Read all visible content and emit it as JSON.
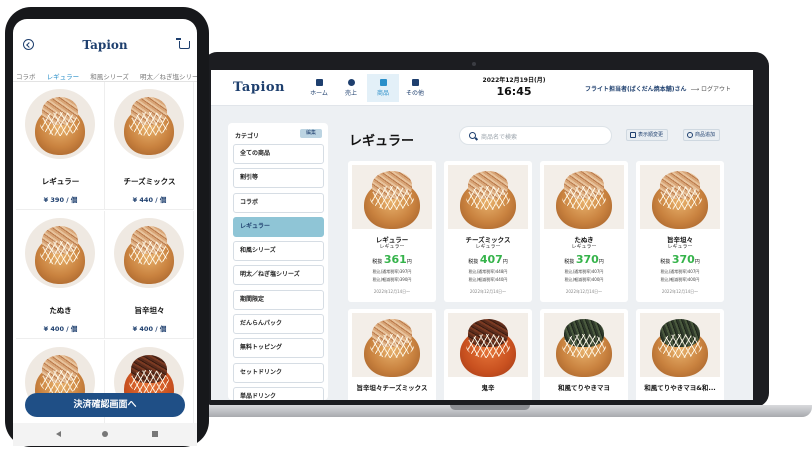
{
  "desktop": {
    "brand": "Tapion",
    "nav": [
      {
        "label": "ホーム",
        "icon": "home-grid-icon"
      },
      {
        "label": "売上",
        "icon": "sales-clock-icon"
      },
      {
        "label": "商品",
        "icon": "product-gift-icon"
      },
      {
        "label": "その他",
        "icon": "more-box-icon"
      }
    ],
    "date": "2022年12月19日(月)",
    "time": "16:45",
    "user": "フライト担当者(ばくだん焼本舗)さん",
    "logout": "ログアウト",
    "category_header": "カテゴリ",
    "category_edit": "編集",
    "categories": [
      "全ての商品",
      "割引等",
      "コラボ",
      "レギュラー",
      "和風シリーズ",
      "明太／ねぎ塩シリーズ",
      "期間限定",
      "だんらんパック",
      "無料トッピング",
      "セットドリンク",
      "単品ドリンク"
    ],
    "active_category": "レギュラー",
    "title": "レギュラー",
    "search_placeholder": "商品名で検索",
    "toolbar": {
      "reorder": "表示順変更",
      "add": "商品追加"
    },
    "products": [
      {
        "name": "レギュラー",
        "category": "レギュラー",
        "price_label": "税抜",
        "price": "361",
        "unit": "円",
        "eat_in": "税込(通常税率)397円",
        "takeout": "税込(軽減税率)390円",
        "since": "2022年12月14日〜",
        "topping": "bonito"
      },
      {
        "name": "チーズミックス",
        "category": "レギュラー",
        "price_label": "税抜",
        "price": "407",
        "unit": "円",
        "eat_in": "税込(通常税率)448円",
        "takeout": "税込(軽減税率)440円",
        "since": "2022年12月14日〜",
        "topping": "bonito"
      },
      {
        "name": "たぬき",
        "category": "レギュラー",
        "price_label": "税抜",
        "price": "370",
        "unit": "円",
        "eat_in": "税込(通常税率)407円",
        "takeout": "税込(軽減税率)400円",
        "since": "2022年12月14日〜",
        "topping": "bonito"
      },
      {
        "name": "旨辛坦々",
        "category": "レギュラー",
        "price_label": "税抜",
        "price": "370",
        "unit": "円",
        "eat_in": "税込(通常税率)407円",
        "takeout": "税込(軽減税率)400円",
        "since": "2022年12月14日〜",
        "topping": "bonito"
      },
      {
        "name": "旨辛坦々チーズミックス",
        "topping": "bonito"
      },
      {
        "name": "鬼辛",
        "topping": "beef"
      },
      {
        "name": "和風てりやきマヨ",
        "topping": "nori"
      },
      {
        "name": "和風てりやきマヨ&和...",
        "topping": "nori"
      }
    ]
  },
  "phone": {
    "brand": "Tapion",
    "tabs": [
      "コラボ",
      "レギュラー",
      "和風シリーズ",
      "明太／ねぎ塩シリー"
    ],
    "active_tab": "レギュラー",
    "items": [
      {
        "name": "レギュラー",
        "price": "¥ 390 / 個"
      },
      {
        "name": "チーズミックス",
        "price": "¥ 440 / 個"
      },
      {
        "name": "たぬき",
        "price": "¥ 400 / 個"
      },
      {
        "name": "旨辛坦々",
        "price": "¥ 400 / 個"
      },
      {
        "name": "",
        "price": ""
      },
      {
        "name": "",
        "price": ""
      }
    ],
    "cta": "決済確認画面へ"
  }
}
